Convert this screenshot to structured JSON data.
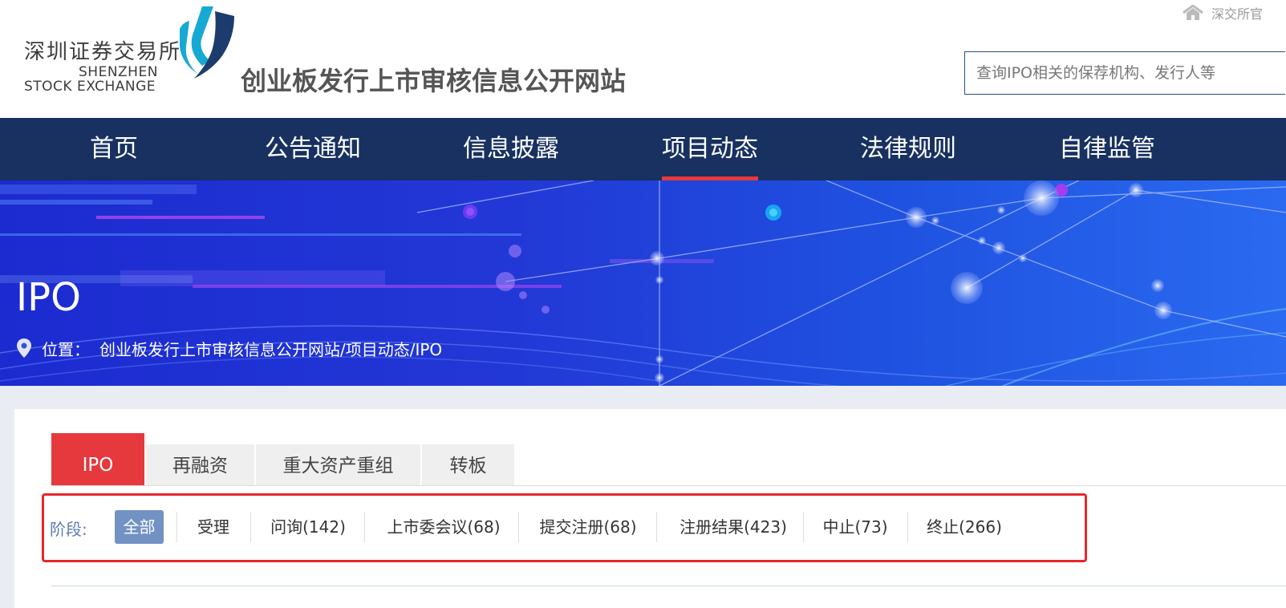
{
  "header": {
    "logo": {
      "cn": "深圳证券交易所",
      "en_line1": "SHENZHEN",
      "en_line2": "STOCK EXCHANGE"
    },
    "site_title": "创业板发行上市审核信息公开网站",
    "home_link": {
      "label": "深交所官",
      "icon": "home-icon"
    },
    "search": {
      "placeholder": "查询IPO相关的保荐机构、发行人等"
    }
  },
  "nav": {
    "items": [
      {
        "label": "首页",
        "active": false
      },
      {
        "label": "公告通知",
        "active": false
      },
      {
        "label": "信息披露",
        "active": false
      },
      {
        "label": "项目动态",
        "active": true
      },
      {
        "label": "法律规则",
        "active": false
      },
      {
        "label": "自律监管",
        "active": false
      }
    ],
    "active_underline_color": "#e5393d"
  },
  "banner": {
    "title": "IPO",
    "breadcrumb": {
      "icon": "location-pin-icon",
      "label": "位置：",
      "path": "创业板发行上市审核信息公开网站/项目动态/IPO"
    }
  },
  "tabs": {
    "items": [
      {
        "label": "IPO",
        "active": true
      },
      {
        "label": "再融资",
        "active": false
      },
      {
        "label": "重大资产重组",
        "active": false
      },
      {
        "label": "转板",
        "active": false
      }
    ],
    "active_color": "#e5393d"
  },
  "stage_filter": {
    "label": "阶段:",
    "items": [
      {
        "label": "全部",
        "active": true
      },
      {
        "label": "受理",
        "active": false
      },
      {
        "label": "问询(142)",
        "active": false
      },
      {
        "label": "上市委会议(68)",
        "active": false
      },
      {
        "label": "提交注册(68)",
        "active": false
      },
      {
        "label": "注册结果(423)",
        "active": false
      },
      {
        "label": "中止(73)",
        "active": false
      },
      {
        "label": "终止(266)",
        "active": false
      }
    ],
    "highlight_border_color": "#e8262b",
    "active_color": "#7292c4"
  },
  "colors": {
    "nav_bg": "#183161",
    "banner_blue": "#2238d6",
    "accent_red": "#e5393d"
  }
}
